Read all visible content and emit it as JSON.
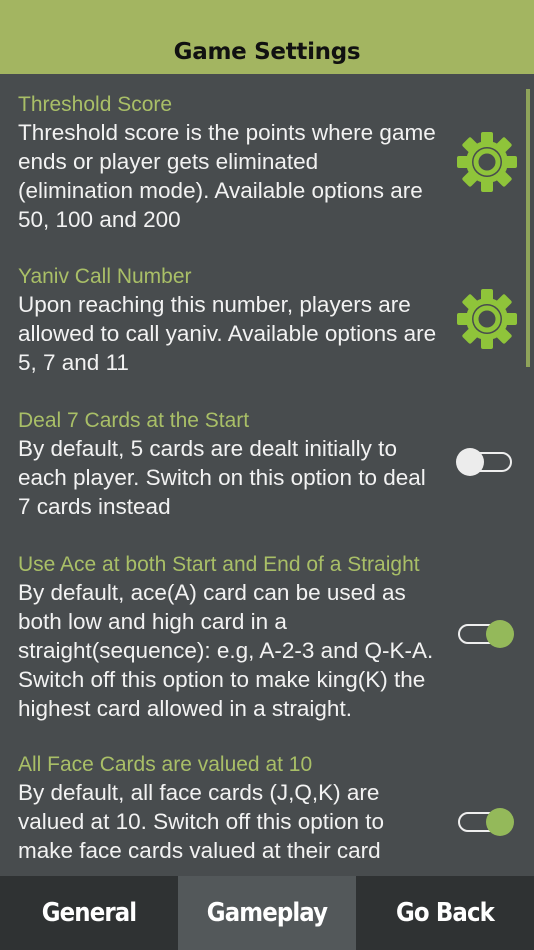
{
  "header": {
    "title": "Game Settings"
  },
  "settings": [
    {
      "title": "Threshold Score",
      "description": "Threshold score is the points where game\nends or player gets eliminated\n(elimination mode). Available options are\n50, 100 and 200",
      "control": "gear-icon"
    },
    {
      "title": "Yaniv Call Number",
      "description": "Upon reaching this number, players are\nallowed to call yaniv. Available options are\n5, 7 and 11",
      "control": "gear-icon"
    },
    {
      "title": "Deal 7 Cards at the Start",
      "description": "By default, 5 cards are dealt initially to\neach player. Switch on this option to deal\n7 cards instead",
      "control": "toggle",
      "toggle_on": false
    },
    {
      "title": "Use Ace at both Start and End of a Straight",
      "description": "By default, ace(A) card can be used as\nboth low and high card in a\nstraight(sequence): e.g, A-2-3 and Q-K-A.\nSwitch off this option to make king(K) the\nhighest card allowed in a straight.",
      "control": "toggle",
      "toggle_on": true
    },
    {
      "title": "All Face Cards are valued at 10",
      "description": "By default, all face cards (J,Q,K) are\nvalued at 10. Switch off this option to\nmake face cards valued at their card",
      "control": "toggle",
      "toggle_on": true
    }
  ],
  "tabs": [
    {
      "label": "General",
      "active": false
    },
    {
      "label": "Gameplay",
      "active": true
    },
    {
      "label": "Go Back",
      "active": false
    }
  ],
  "colors": {
    "accent": "#a3b561",
    "title_green": "#a9bf67",
    "toggle_on": "#94b95a",
    "gear": "#8fc43a",
    "background": "#484c4e",
    "tabbar": "#2f3233"
  }
}
